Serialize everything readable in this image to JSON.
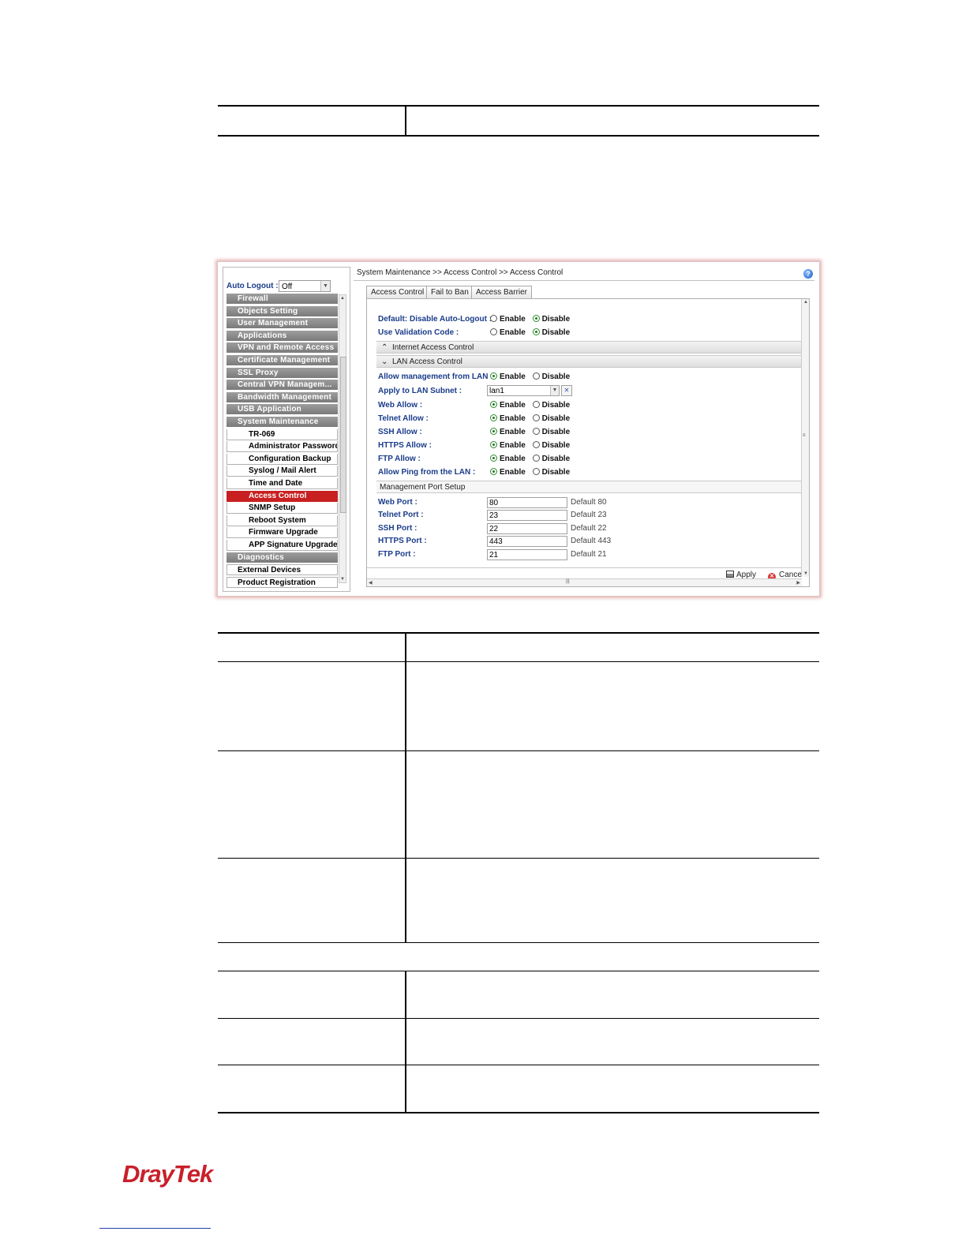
{
  "breadcrumb": "System Maintenance >> Access Control >> Access Control",
  "auto_logout": {
    "label": "Auto Logout :",
    "value": "Off"
  },
  "menu": [
    {
      "label": "Firewall",
      "kind": "group"
    },
    {
      "label": "Objects Setting",
      "kind": "group"
    },
    {
      "label": "User Management",
      "kind": "group"
    },
    {
      "label": "Applications",
      "kind": "group"
    },
    {
      "label": "VPN and Remote Access",
      "kind": "group"
    },
    {
      "label": "Certificate Management",
      "kind": "group"
    },
    {
      "label": "SSL Proxy",
      "kind": "group"
    },
    {
      "label": "Central VPN Managem...",
      "kind": "group"
    },
    {
      "label": "Bandwidth Management",
      "kind": "group"
    },
    {
      "label": "USB Application",
      "kind": "group"
    },
    {
      "label": "System Maintenance",
      "kind": "group"
    },
    {
      "label": "TR-069",
      "kind": "sub"
    },
    {
      "label": "Administrator Password",
      "kind": "sub"
    },
    {
      "label": "Configuration Backup",
      "kind": "sub"
    },
    {
      "label": "Syslog / Mail Alert",
      "kind": "sub"
    },
    {
      "label": "Time and Date",
      "kind": "sub"
    },
    {
      "label": "Access Control",
      "kind": "sub",
      "active": true
    },
    {
      "label": "SNMP Setup",
      "kind": "sub"
    },
    {
      "label": "Reboot System",
      "kind": "sub"
    },
    {
      "label": "Firmware Upgrade",
      "kind": "sub"
    },
    {
      "label": "APP Signature Upgrade",
      "kind": "sub"
    },
    {
      "label": "Diagnostics",
      "kind": "group"
    },
    {
      "label": "External Devices",
      "kind": "plain"
    },
    {
      "label": "Product Registration",
      "kind": "plain"
    }
  ],
  "tabs": [
    "Access Control",
    "Fail to Ban",
    "Access Barrier"
  ],
  "options": {
    "enable": "Enable",
    "disable": "Disable"
  },
  "general": [
    {
      "label": "Default: Disable Auto-Logout :",
      "selected": "disable"
    },
    {
      "label": "Use Validation Code :",
      "selected": "disable"
    }
  ],
  "sections": {
    "internet": "Internet Access Control",
    "lan": "LAN Access Control",
    "ports": "Management Port Setup"
  },
  "lan_settings": [
    {
      "label": "Allow management from LAN :",
      "selected": "enable"
    },
    {
      "label": "Apply to LAN Subnet :",
      "value": "lan1"
    },
    {
      "label": "Web Allow :",
      "selected": "enable"
    },
    {
      "label": "Telnet Allow :",
      "selected": "enable"
    },
    {
      "label": "SSH Allow :",
      "selected": "enable"
    },
    {
      "label": "HTTPS Allow :",
      "selected": "enable"
    },
    {
      "label": "FTP Allow :",
      "selected": "enable"
    },
    {
      "label": "Allow Ping from the LAN :",
      "selected": "enable"
    }
  ],
  "ports": [
    {
      "label": "Web Port :",
      "value": "80",
      "note": "Default 80"
    },
    {
      "label": "Telnet Port :",
      "value": "23",
      "note": "Default 23"
    },
    {
      "label": "SSH Port :",
      "value": "22",
      "note": "Default 22"
    },
    {
      "label": "HTTPS Port :",
      "value": "443",
      "note": "Default 443"
    },
    {
      "label": "FTP Port :",
      "value": "21",
      "note": "Default 21"
    }
  ],
  "buttons": {
    "apply": "Apply",
    "cancel": "Cancel"
  },
  "logo": "DrayTek"
}
